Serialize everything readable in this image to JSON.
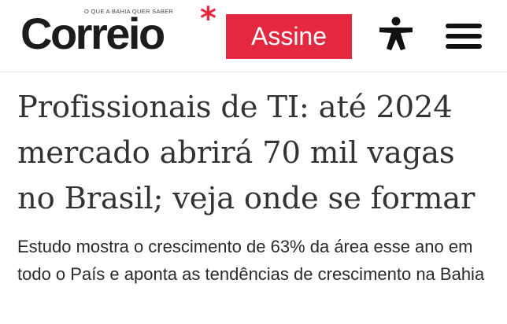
{
  "header": {
    "logo": {
      "wordmark": "Correio",
      "asterisk": "*",
      "tagline": "O QUE A BAHIA QUER SABER",
      "accent_color": "#e3283f"
    },
    "subscribe_label": "Assine",
    "accessibility_icon": "accessibility-person-icon",
    "menu_icon": "hamburger-menu-icon"
  },
  "article": {
    "headline": "Profissionais de TI: até 2024 mercado abrirá 70 mil vagas no Brasil; veja onde se formar",
    "subheadline": "Estudo mostra o crescimento de 63% da área esse ano em todo o País e aponta as tendências de crescimento na Bahia"
  }
}
